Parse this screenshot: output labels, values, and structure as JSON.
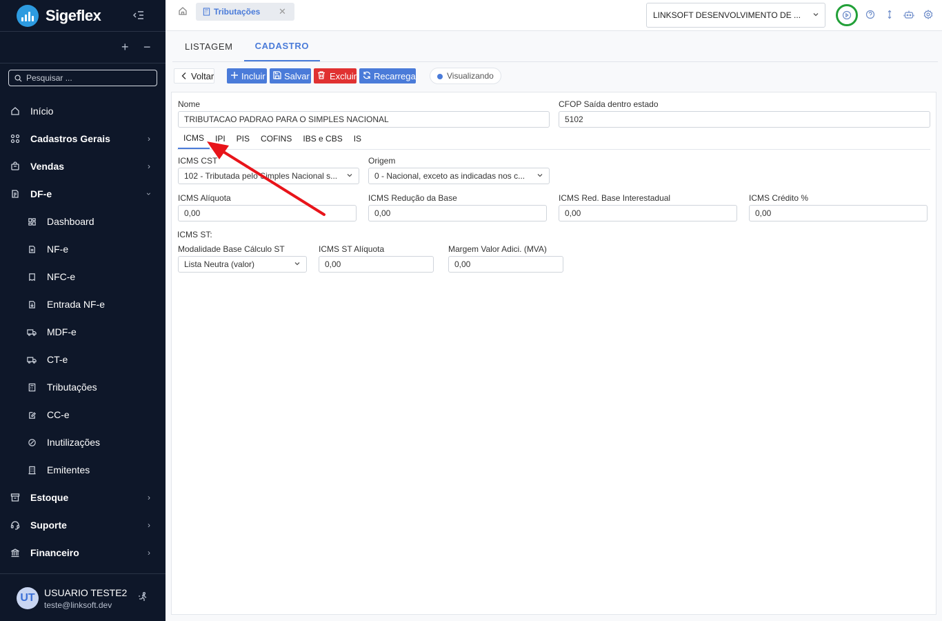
{
  "app": {
    "brand_name": "Sigeflex",
    "search_placeholder": "Pesquisar ..."
  },
  "sidebar": {
    "items": [
      {
        "label": "Início",
        "icon": "home-icon"
      },
      {
        "label": "Cadastros Gerais",
        "icon": "grid-icon"
      },
      {
        "label": "Vendas",
        "icon": "shopping-bag-icon"
      },
      {
        "label": "DF-e",
        "icon": "document-icon"
      },
      {
        "label": "Dashboard",
        "icon": "dashboard-icon"
      },
      {
        "label": "NF-e",
        "icon": "file-icon"
      },
      {
        "label": "NFC-e",
        "icon": "receipt-icon"
      },
      {
        "label": "Entrada NF-e",
        "icon": "file-import-icon"
      },
      {
        "label": "MDF-e",
        "icon": "truck-icon"
      },
      {
        "label": "CT-e",
        "icon": "truck-icon"
      },
      {
        "label": "Tributações",
        "icon": "calculator-icon"
      },
      {
        "label": "CC-e",
        "icon": "file-edit-icon"
      },
      {
        "label": "Inutilizações",
        "icon": "ban-icon"
      },
      {
        "label": "Emitentes",
        "icon": "building-icon"
      },
      {
        "label": "Estoque",
        "icon": "archive-icon"
      },
      {
        "label": "Suporte",
        "icon": "headset-icon"
      },
      {
        "label": "Financeiro",
        "icon": "bank-icon"
      }
    ]
  },
  "user": {
    "initials": "UT",
    "name": "USUARIO TESTE2",
    "email": "teste@linksoft.dev"
  },
  "topbar": {
    "open_tab": "Tributações",
    "company": "LINKSOFT DESENVOLVIMENTO DE ..."
  },
  "main": {
    "tabs": [
      "LISTAGEM",
      "CADASTRO"
    ],
    "toolbar": {
      "back": "Voltar",
      "add": "Incluir",
      "save": "Salvar",
      "delete": "Excluir",
      "reload": "Recarrega",
      "status": "Visualizando"
    },
    "form": {
      "nome_label": "Nome",
      "nome_value": "TRIBUTACAO PADRAO PARA O SIMPLES NACIONAL",
      "cfop_label": "CFOP Saída dentro estado",
      "cfop_value": "5102",
      "subtabs": [
        "ICMS",
        "IPI",
        "PIS",
        "COFINS",
        "IBS e CBS",
        "IS"
      ],
      "icms_cst_label": "ICMS CST",
      "icms_cst_value": "102 - Tributada pelo Simples Nacional s...",
      "origem_label": "Origem",
      "origem_value": "0 - Nacional, exceto as indicadas nos c...",
      "aliquota_label": "ICMS Alíquota",
      "aliquota_value": "0,00",
      "reducao_label": "ICMS Redução da Base",
      "reducao_value": "0,00",
      "red_inter_label": "ICMS Red. Base Interestadual",
      "red_inter_value": "0,00",
      "credito_label": "ICMS Crédito %",
      "credito_value": "0,00",
      "st_section": "ICMS ST:",
      "modalidade_label": "Modalidade Base Cálculo ST",
      "modalidade_value": "Lista Neutra (valor)",
      "st_aliquota_label": "ICMS ST Alíquota",
      "st_aliquota_value": "0,00",
      "mva_label": "Margem Valor Adici. (MVA)",
      "mva_value": "0,00"
    }
  },
  "colors": {
    "sidebar_bg": "#0e1729",
    "accent": "#4a7bd9",
    "danger": "#e03131",
    "tour_ring": "#22a038",
    "annotation_arrow": "#e8141a"
  }
}
